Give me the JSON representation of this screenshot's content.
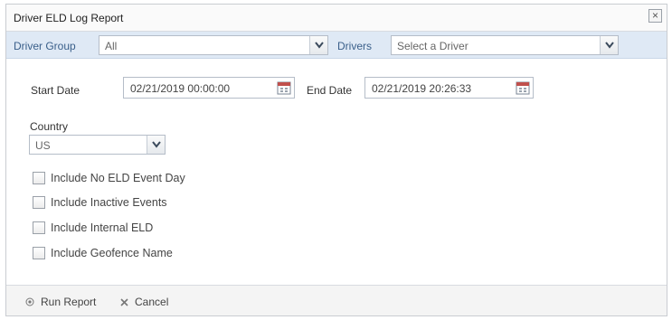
{
  "dialog": {
    "title": "Driver ELD Log Report",
    "close_symbol": "×"
  },
  "filters": {
    "driver_group_label": "Driver Group",
    "driver_group_value": "All",
    "drivers_label": "Drivers",
    "drivers_placeholder": "Select a Driver"
  },
  "dates": {
    "start_label": "Start Date",
    "start_value": "02/21/2019 00:00:00",
    "end_label": "End Date",
    "end_value": "02/21/2019 20:26:33"
  },
  "country": {
    "label": "Country",
    "value": "US"
  },
  "options": [
    {
      "label": "Include No ELD Event Day",
      "checked": false
    },
    {
      "label": "Include Inactive Events",
      "checked": false
    },
    {
      "label": "Include Internal ELD",
      "checked": false
    },
    {
      "label": "Include Geofence Name",
      "checked": false
    }
  ],
  "footer": {
    "run_label": "Run Report",
    "cancel_label": "Cancel"
  },
  "colors": {
    "filter_bar": "#dfe9f5",
    "label_blue": "#3a5f8a"
  },
  "icons": [
    "close-icon",
    "chevron-down-icon",
    "calendar-icon",
    "run-icon",
    "cancel-icon"
  ]
}
